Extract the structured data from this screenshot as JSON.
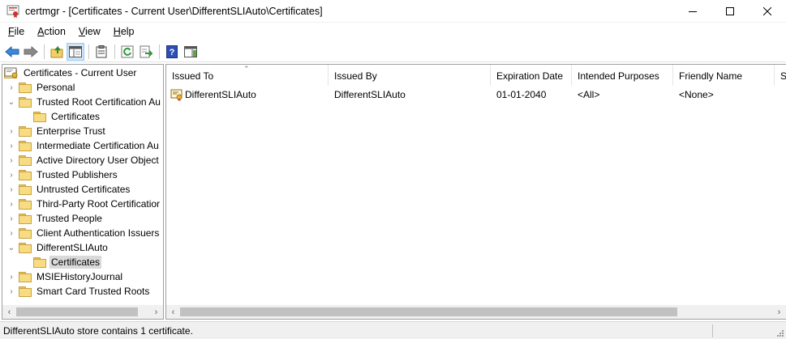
{
  "window": {
    "title": "certmgr - [Certificates - Current User\\DifferentSLIAuto\\Certificates]",
    "icon": "certmgr-app-icon",
    "controls": [
      "minimize-icon",
      "maximize-icon",
      "close-icon"
    ]
  },
  "menu": {
    "file": {
      "accel": "F",
      "rest": "ile"
    },
    "action": {
      "accel": "A",
      "rest": "ction"
    },
    "view": {
      "accel": "V",
      "rest": "iew"
    },
    "help": {
      "accel": "H",
      "rest": "elp"
    }
  },
  "toolbar": {
    "icons": [
      "back-arrow-icon",
      "forward-arrow-icon",
      "up-folder-icon",
      "show-hide-tree-icon",
      "properties-icon",
      "refresh-icon",
      "export-list-icon",
      "help-icon",
      "show-hide-action-pane-icon"
    ]
  },
  "tree": {
    "root": "Certificates - Current User",
    "items": [
      {
        "label": "Personal",
        "expander": "›"
      },
      {
        "label": "Trusted Root Certification Au",
        "expander": "⌄"
      },
      {
        "label": "Certificates",
        "expander": ""
      },
      {
        "label": "Enterprise Trust",
        "expander": "›"
      },
      {
        "label": "Intermediate Certification Au",
        "expander": "›"
      },
      {
        "label": "Active Directory User Object",
        "expander": "›"
      },
      {
        "label": "Trusted Publishers",
        "expander": "›"
      },
      {
        "label": "Untrusted Certificates",
        "expander": "›"
      },
      {
        "label": "Third-Party Root Certificatior",
        "expander": "›"
      },
      {
        "label": "Trusted People",
        "expander": "›"
      },
      {
        "label": "Client Authentication Issuers",
        "expander": "›"
      },
      {
        "label": "DifferentSLIAuto",
        "expander": "⌄"
      },
      {
        "label": "Certificates",
        "expander": ""
      },
      {
        "label": "MSIEHistoryJournal",
        "expander": "›"
      },
      {
        "label": "Smart Card Trusted Roots",
        "expander": "›"
      }
    ]
  },
  "list": {
    "columns": [
      "Issued To",
      "Issued By",
      "Expiration Date",
      "Intended Purposes",
      "Friendly Name",
      "S"
    ],
    "rows": [
      [
        "DifferentSLIAuto",
        "DifferentSLIAuto",
        "01-01-2040",
        "<All>",
        "<None>"
      ]
    ]
  },
  "scroll": {
    "left_arrow": "‹",
    "right_arrow": "›"
  },
  "status": {
    "text": "DifferentSLIAuto store contains 1 certificate."
  },
  "colors": {
    "selection": "#d9d9d9",
    "folder": "#f8dc83",
    "scroll_thumb": "#c1c1c1",
    "status_bg": "#f0f0f0"
  }
}
